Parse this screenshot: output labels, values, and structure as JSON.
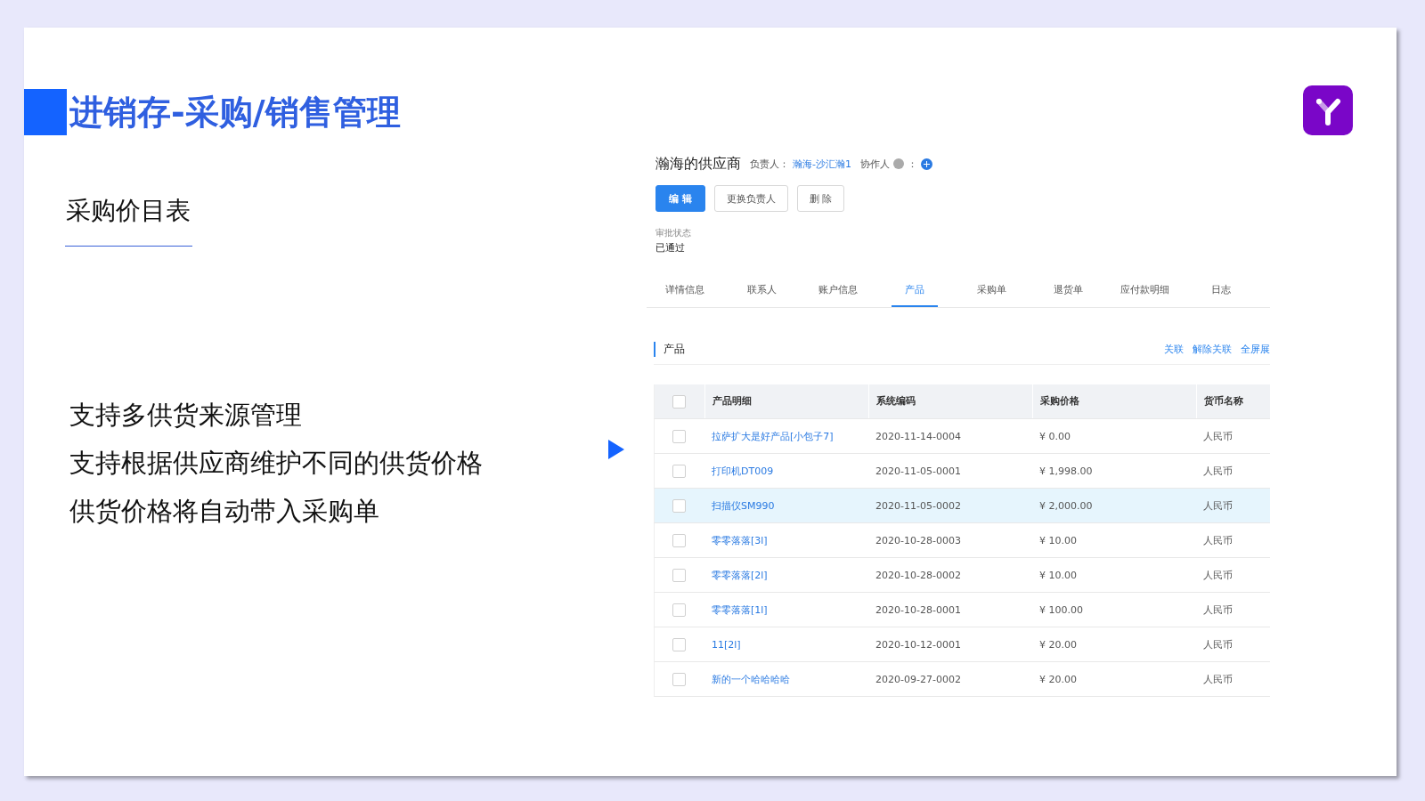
{
  "slide": {
    "title": "进销存-采购/销售管理",
    "subtitle": "采购价目表",
    "points": [
      "支持多供货来源管理",
      "支持根据供应商维护不同的供货价格",
      "供货价格将自动带入采购单"
    ]
  },
  "app": {
    "supplier": "瀚海的供应商",
    "owner_label": "负责人：",
    "owner": "瀚海-沙汇瀚1",
    "collab_label": "协作人",
    "collab_colon": "：",
    "buttons": [
      {
        "label": "编 辑",
        "kind": "primary"
      },
      {
        "label": "更换负责人",
        "kind": "default"
      },
      {
        "label": "删 除",
        "kind": "default"
      }
    ],
    "approval_label": "审批状态",
    "approval_value": "已通过",
    "tabs": [
      {
        "label": "详情信息",
        "selected": false
      },
      {
        "label": "联系人",
        "selected": false
      },
      {
        "label": "账户信息",
        "selected": false
      },
      {
        "label": "产品",
        "selected": true
      },
      {
        "label": "采购单",
        "selected": false
      },
      {
        "label": "退货单",
        "selected": false
      },
      {
        "label": "应付款明细",
        "selected": false
      },
      {
        "label": "日志",
        "selected": false
      }
    ],
    "section_title": "产品",
    "section_actions": [
      "关联",
      "解除关联",
      "全屏展"
    ],
    "table": {
      "all_checked": false,
      "columns": [
        "产品明细",
        "系统编码",
        "采购价格",
        "货币名称"
      ],
      "rows": [
        {
          "checked": false,
          "highlighted": false,
          "cells": [
            "拉萨扩大是好产品[小包子7]",
            "2020-11-14-0004",
            "¥ 0.00",
            "人民币"
          ]
        },
        {
          "checked": false,
          "highlighted": false,
          "cells": [
            "打印机DT009",
            "2020-11-05-0001",
            "¥ 1,998.00",
            "人民币"
          ]
        },
        {
          "checked": false,
          "highlighted": true,
          "cells": [
            "扫描仪SM990",
            "2020-11-05-0002",
            "¥ 2,000.00",
            "人民币"
          ]
        },
        {
          "checked": false,
          "highlighted": false,
          "cells": [
            "零零落落[3l]",
            "2020-10-28-0003",
            "¥ 10.00",
            "人民币"
          ]
        },
        {
          "checked": false,
          "highlighted": false,
          "cells": [
            "零零落落[2l]",
            "2020-10-28-0002",
            "¥ 10.00",
            "人民币"
          ]
        },
        {
          "checked": false,
          "highlighted": false,
          "cells": [
            "零零落落[1l]",
            "2020-10-28-0001",
            "¥ 100.00",
            "人民币"
          ]
        },
        {
          "checked": false,
          "highlighted": false,
          "cells": [
            "11[2l]",
            "2020-10-12-0001",
            "¥ 20.00",
            "人民币"
          ]
        },
        {
          "checked": false,
          "highlighted": false,
          "cells": [
            "新的一个哈哈哈哈",
            "2020-09-27-0002",
            "¥ 20.00",
            "人民币"
          ]
        }
      ]
    }
  }
}
